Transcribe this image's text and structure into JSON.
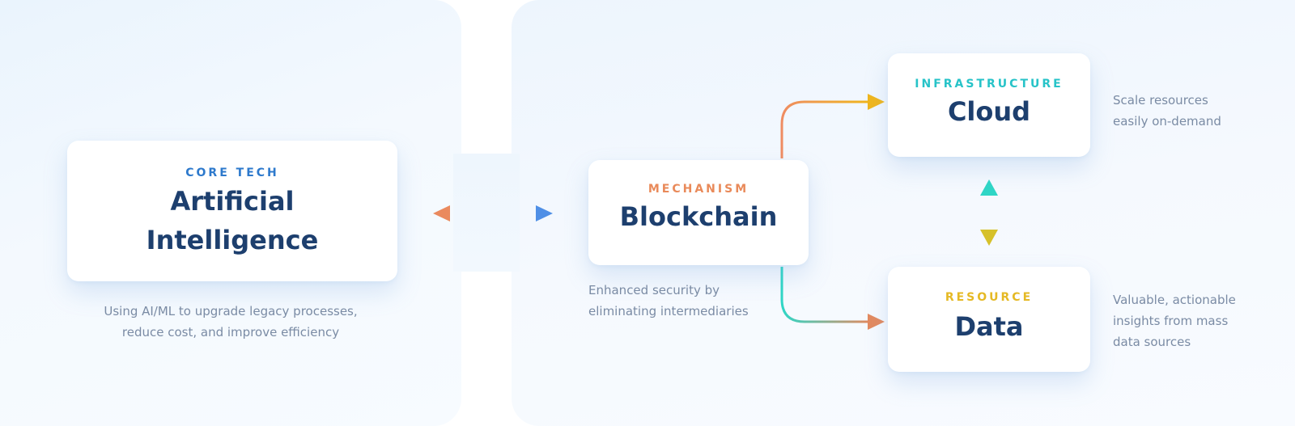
{
  "nodes": {
    "ai": {
      "eyebrow": "CORE TECH",
      "title_line1": "Artificial",
      "title_line2": "Intelligence",
      "caption_line1": "Using AI/ML to upgrade legacy processes,",
      "caption_line2": "reduce cost, and improve efficiency"
    },
    "blockchain": {
      "eyebrow": "MECHANISM",
      "title": "Blockchain",
      "caption_line1": "Enhanced security by",
      "caption_line2": "eliminating intermediaries"
    },
    "cloud": {
      "eyebrow": "INFRASTRUCTURE",
      "title": "Cloud",
      "caption_line1": "Scale resources",
      "caption_line2": "easily on-demand"
    },
    "data": {
      "eyebrow": "RESOURCE",
      "title": "Data",
      "caption_line1": "Valuable, actionable",
      "caption_line2": "insights from mass",
      "caption_line3": "data sources"
    }
  },
  "colors": {
    "title": "#1d3f6e",
    "caption": "#7a8ba4",
    "core_tech": "#2d79cc",
    "mechanism": "#e98a5a",
    "infrastructure": "#27c3c8",
    "resource": "#e5b924",
    "arrow_orange": "#ea8a5e",
    "arrow_blue": "#4f8fe6",
    "arrow_yellow": "#f0b61c",
    "arrow_teal": "#2fd6c6",
    "arrow_olive": "#d6c12a"
  },
  "edges": [
    {
      "from": "ai",
      "to": "blockchain",
      "direction": "bidirectional"
    },
    {
      "from": "blockchain",
      "to": "cloud",
      "direction": "forward"
    },
    {
      "from": "blockchain",
      "to": "data",
      "direction": "forward"
    },
    {
      "from": "cloud",
      "to": "data",
      "direction": "bidirectional"
    }
  ]
}
